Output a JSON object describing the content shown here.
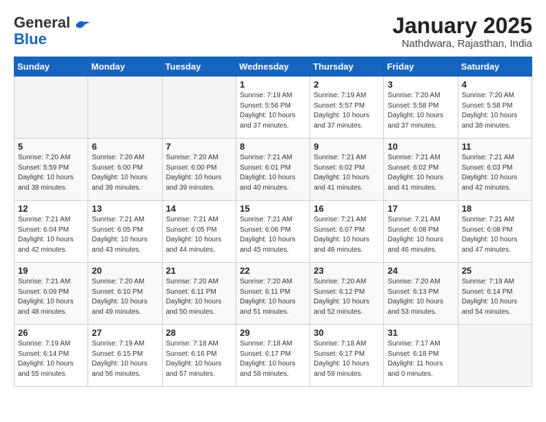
{
  "header": {
    "logo_general": "General",
    "logo_blue": "Blue",
    "month": "January 2025",
    "location": "Nathdwara, Rajasthan, India"
  },
  "days_of_week": [
    "Sunday",
    "Monday",
    "Tuesday",
    "Wednesday",
    "Thursday",
    "Friday",
    "Saturday"
  ],
  "weeks": [
    [
      {
        "day": "",
        "info": ""
      },
      {
        "day": "",
        "info": ""
      },
      {
        "day": "",
        "info": ""
      },
      {
        "day": "1",
        "info": "Sunrise: 7:19 AM\nSunset: 5:56 PM\nDaylight: 10 hours\nand 37 minutes."
      },
      {
        "day": "2",
        "info": "Sunrise: 7:19 AM\nSunset: 5:57 PM\nDaylight: 10 hours\nand 37 minutes."
      },
      {
        "day": "3",
        "info": "Sunrise: 7:20 AM\nSunset: 5:58 PM\nDaylight: 10 hours\nand 37 minutes."
      },
      {
        "day": "4",
        "info": "Sunrise: 7:20 AM\nSunset: 5:58 PM\nDaylight: 10 hours\nand 38 minutes."
      }
    ],
    [
      {
        "day": "5",
        "info": "Sunrise: 7:20 AM\nSunset: 5:59 PM\nDaylight: 10 hours\nand 38 minutes."
      },
      {
        "day": "6",
        "info": "Sunrise: 7:20 AM\nSunset: 6:00 PM\nDaylight: 10 hours\nand 39 minutes."
      },
      {
        "day": "7",
        "info": "Sunrise: 7:20 AM\nSunset: 6:00 PM\nDaylight: 10 hours\nand 39 minutes."
      },
      {
        "day": "8",
        "info": "Sunrise: 7:21 AM\nSunset: 6:01 PM\nDaylight: 10 hours\nand 40 minutes."
      },
      {
        "day": "9",
        "info": "Sunrise: 7:21 AM\nSunset: 6:02 PM\nDaylight: 10 hours\nand 41 minutes."
      },
      {
        "day": "10",
        "info": "Sunrise: 7:21 AM\nSunset: 6:02 PM\nDaylight: 10 hours\nand 41 minutes."
      },
      {
        "day": "11",
        "info": "Sunrise: 7:21 AM\nSunset: 6:03 PM\nDaylight: 10 hours\nand 42 minutes."
      }
    ],
    [
      {
        "day": "12",
        "info": "Sunrise: 7:21 AM\nSunset: 6:04 PM\nDaylight: 10 hours\nand 42 minutes."
      },
      {
        "day": "13",
        "info": "Sunrise: 7:21 AM\nSunset: 6:05 PM\nDaylight: 10 hours\nand 43 minutes."
      },
      {
        "day": "14",
        "info": "Sunrise: 7:21 AM\nSunset: 6:05 PM\nDaylight: 10 hours\nand 44 minutes."
      },
      {
        "day": "15",
        "info": "Sunrise: 7:21 AM\nSunset: 6:06 PM\nDaylight: 10 hours\nand 45 minutes."
      },
      {
        "day": "16",
        "info": "Sunrise: 7:21 AM\nSunset: 6:07 PM\nDaylight: 10 hours\nand 46 minutes."
      },
      {
        "day": "17",
        "info": "Sunrise: 7:21 AM\nSunset: 6:08 PM\nDaylight: 10 hours\nand 46 minutes."
      },
      {
        "day": "18",
        "info": "Sunrise: 7:21 AM\nSunset: 6:08 PM\nDaylight: 10 hours\nand 47 minutes."
      }
    ],
    [
      {
        "day": "19",
        "info": "Sunrise: 7:21 AM\nSunset: 6:09 PM\nDaylight: 10 hours\nand 48 minutes."
      },
      {
        "day": "20",
        "info": "Sunrise: 7:20 AM\nSunset: 6:10 PM\nDaylight: 10 hours\nand 49 minutes."
      },
      {
        "day": "21",
        "info": "Sunrise: 7:20 AM\nSunset: 6:11 PM\nDaylight: 10 hours\nand 50 minutes."
      },
      {
        "day": "22",
        "info": "Sunrise: 7:20 AM\nSunset: 6:11 PM\nDaylight: 10 hours\nand 51 minutes."
      },
      {
        "day": "23",
        "info": "Sunrise: 7:20 AM\nSunset: 6:12 PM\nDaylight: 10 hours\nand 52 minutes."
      },
      {
        "day": "24",
        "info": "Sunrise: 7:20 AM\nSunset: 6:13 PM\nDaylight: 10 hours\nand 53 minutes."
      },
      {
        "day": "25",
        "info": "Sunrise: 7:19 AM\nSunset: 6:14 PM\nDaylight: 10 hours\nand 54 minutes."
      }
    ],
    [
      {
        "day": "26",
        "info": "Sunrise: 7:19 AM\nSunset: 6:14 PM\nDaylight: 10 hours\nand 55 minutes."
      },
      {
        "day": "27",
        "info": "Sunrise: 7:19 AM\nSunset: 6:15 PM\nDaylight: 10 hours\nand 56 minutes."
      },
      {
        "day": "28",
        "info": "Sunrise: 7:18 AM\nSunset: 6:16 PM\nDaylight: 10 hours\nand 57 minutes."
      },
      {
        "day": "29",
        "info": "Sunrise: 7:18 AM\nSunset: 6:17 PM\nDaylight: 10 hours\nand 58 minutes."
      },
      {
        "day": "30",
        "info": "Sunrise: 7:18 AM\nSunset: 6:17 PM\nDaylight: 10 hours\nand 59 minutes."
      },
      {
        "day": "31",
        "info": "Sunrise: 7:17 AM\nSunset: 6:18 PM\nDaylight: 11 hours\nand 0 minutes."
      },
      {
        "day": "",
        "info": ""
      }
    ]
  ]
}
